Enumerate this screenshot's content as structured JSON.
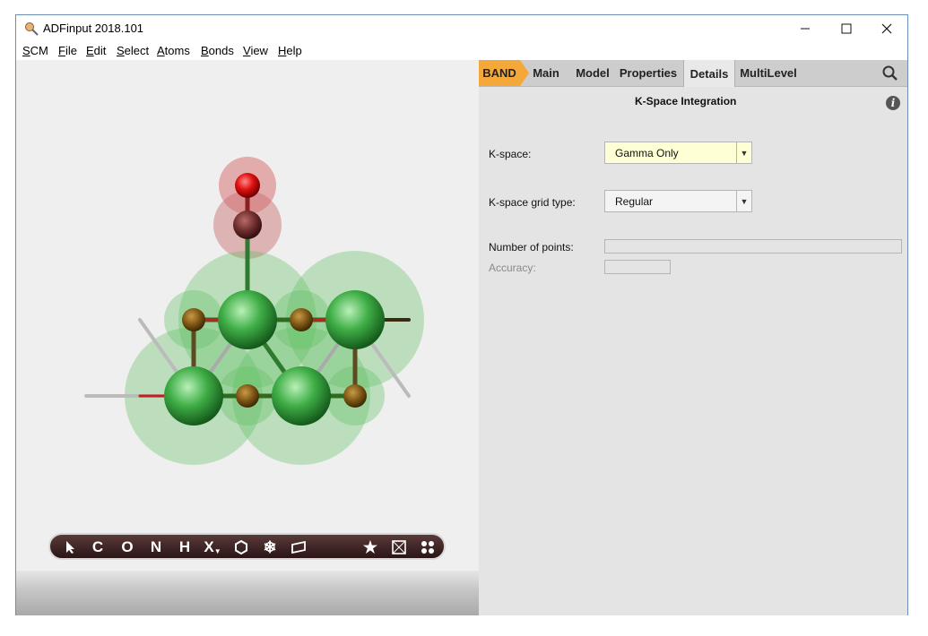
{
  "window": {
    "title": "ADFinput 2018.101"
  },
  "menu": [
    "SCM",
    "File",
    "Edit",
    "Select",
    "Atoms",
    "Bonds",
    "View",
    "Help"
  ],
  "toolbar": {
    "tools": [
      "pointer",
      "C",
      "O",
      "N",
      "H",
      "X",
      "ring",
      "snowflake",
      "plane",
      "star",
      "box",
      "dots"
    ]
  },
  "panel": {
    "tabs": [
      "BAND",
      "Main",
      "Model",
      "Properties",
      "Details",
      "MultiLevel"
    ],
    "active_tab": "Details",
    "section_title": "K-Space Integration",
    "fields": {
      "kspace_label": "K-space:",
      "kspace_value": "Gamma Only",
      "grid_label": "K-space grid type:",
      "grid_value": "Regular",
      "points_label": "Number of points:",
      "accuracy_label": "Accuracy:"
    }
  },
  "colors": {
    "band_tab": "#f5a83a",
    "highlight_select": "#ffffd6"
  }
}
